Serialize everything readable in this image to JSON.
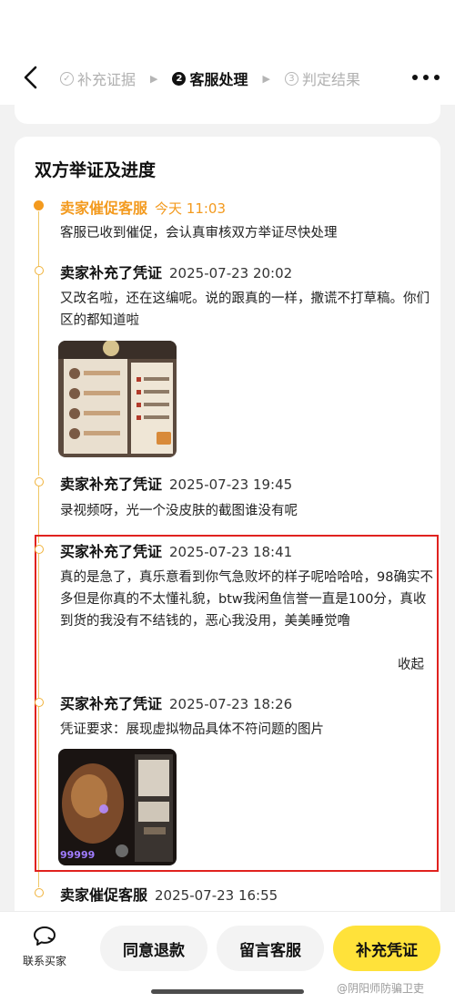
{
  "header": {
    "steps": [
      {
        "num": "✓",
        "label": "补充证据"
      },
      {
        "num": "2",
        "label": "客服处理"
      },
      {
        "num": "3",
        "label": "判定结果"
      }
    ]
  },
  "section": {
    "title": "双方举证及进度"
  },
  "events": [
    {
      "actor": "卖家催促客服",
      "time": "今天 11:03",
      "text": "客服已收到催促，会认真审核双方举证尽快处理"
    },
    {
      "actor": "卖家补充了凭证",
      "time": "2025-07-23 20:02",
      "text": "又改名啦，还在这编呢。说的跟真的一样，撒谎不打草稿。你们区的都知道啦"
    },
    {
      "actor": "卖家补充了凭证",
      "time": "2025-07-23 19:45",
      "text": "录视频呀，光一个没皮肤的截图谁没有呢"
    },
    {
      "actor": "买家补充了凭证",
      "time": "2025-07-23 18:41",
      "text": "真的是急了，真乐意看到你气急败坏的样子呢哈哈哈，98确实不多但是你真的不太懂礼貌，btw我闲鱼信誉一直是100分，真收到货的我没有不结钱的，恶心我没用，美美睡觉噜",
      "collapse": "收起"
    },
    {
      "actor": "买家补充了凭证",
      "time": "2025-07-23 18:26",
      "text": "凭证要求：展现虚拟物品具体不符问题的图片"
    },
    {
      "actor": "卖家催促客服",
      "time": "2025-07-23 16:55"
    }
  ],
  "thumb2": {
    "number": "99999"
  },
  "bottom": {
    "contact_label": "联系买家",
    "agree_refund": "同意退款",
    "message_service": "留言客服",
    "add_evidence": "补充凭证"
  },
  "watermark": "@阴阳师防骗卫吏"
}
